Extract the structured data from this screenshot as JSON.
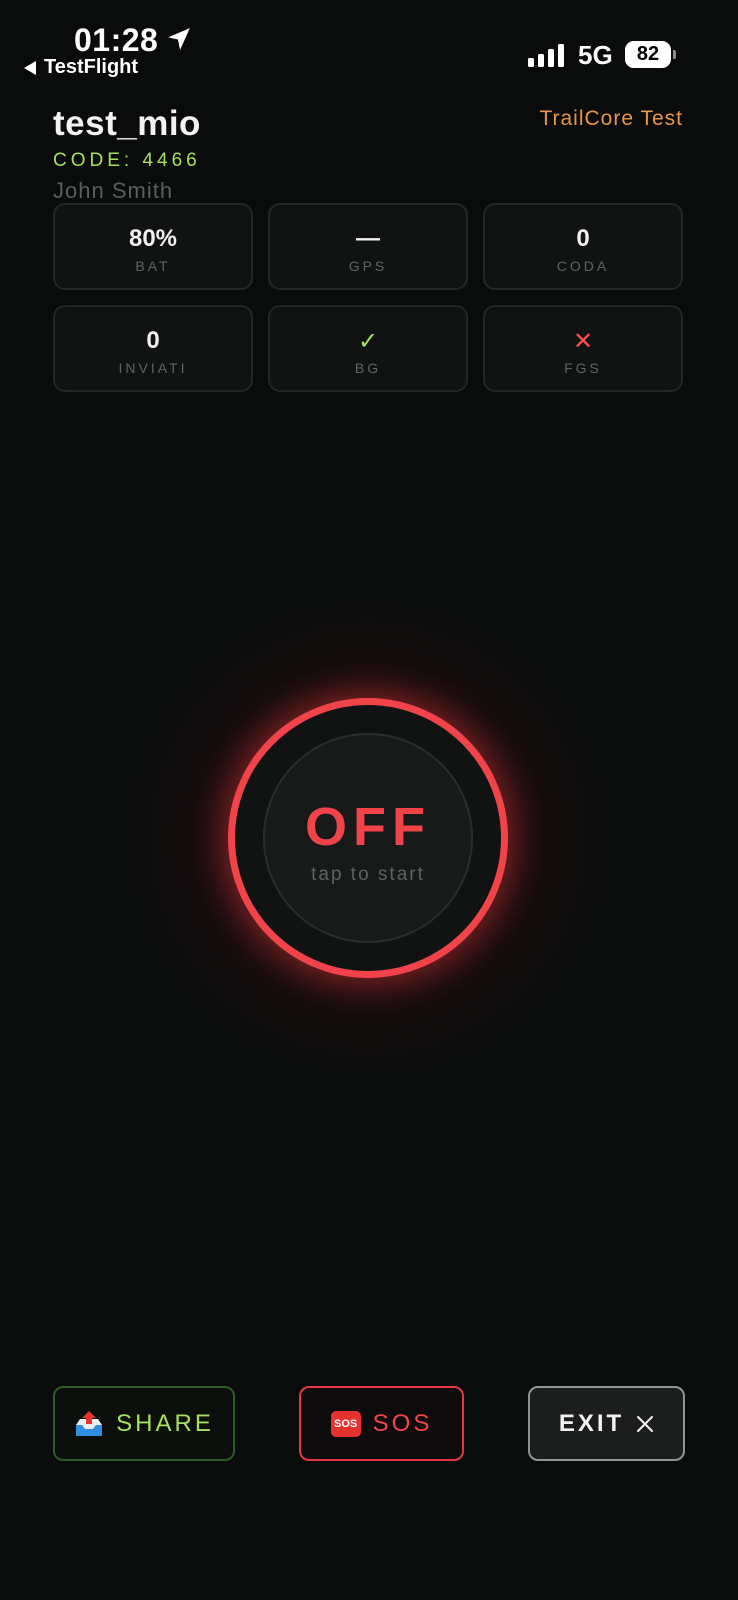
{
  "status_bar": {
    "time": "01:28",
    "back_label": "TestFlight",
    "network": "5G",
    "battery": "82",
    "battery_fraction": 0.82
  },
  "header": {
    "title": "test_mio",
    "code": "CODE: 4466",
    "name": "John Smith",
    "app_name": "TrailCore Test"
  },
  "stats": [
    {
      "value": "80%",
      "label": "BAT"
    },
    {
      "value": "—",
      "label": "GPS"
    },
    {
      "value": "0",
      "label": "CODA"
    },
    {
      "value": "0",
      "label": "INVIATI"
    },
    {
      "value": "✓",
      "label": "BG",
      "icon": "check-icon",
      "color": "#a6e05a"
    },
    {
      "value": "✕",
      "label": "FGS",
      "icon": "cross-icon",
      "color": "#ff4d50"
    }
  ],
  "power": {
    "state": "OFF",
    "hint": "tap to start",
    "color": "#f0444a"
  },
  "actions": {
    "share_label": "SHARE",
    "share_icon": "outbox-tray-icon",
    "sos_label": "SOS",
    "sos_icon": "sos-icon",
    "sos_icon_text": "SOS",
    "exit_label": "EXIT",
    "exit_icon": "close-icon"
  }
}
